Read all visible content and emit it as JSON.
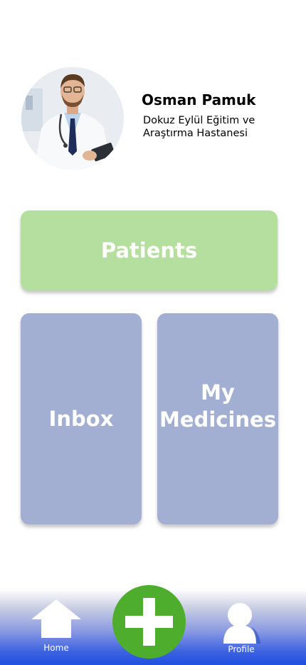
{
  "profile": {
    "name": "Osman Pamuk",
    "hospital_line1": "Dokuz Eylül Eğitim ve",
    "hospital_line2": "Araştırma Hastanesi"
  },
  "tiles": {
    "patients": "Patients",
    "inbox": "Inbox",
    "my_medicines_line1": "My",
    "my_medicines_line2": "Medicines"
  },
  "nav": {
    "home_label": "Home",
    "profile_label": "Profile"
  },
  "colors": {
    "patients_tile": "#b5df9e",
    "secondary_tile": "#a3afd2",
    "add_button": "#4fad2e",
    "nav_gradient_bottom": "#1f4fe0"
  },
  "icons": {
    "home": "home-icon",
    "add": "plus-icon",
    "profile": "user-icon"
  }
}
